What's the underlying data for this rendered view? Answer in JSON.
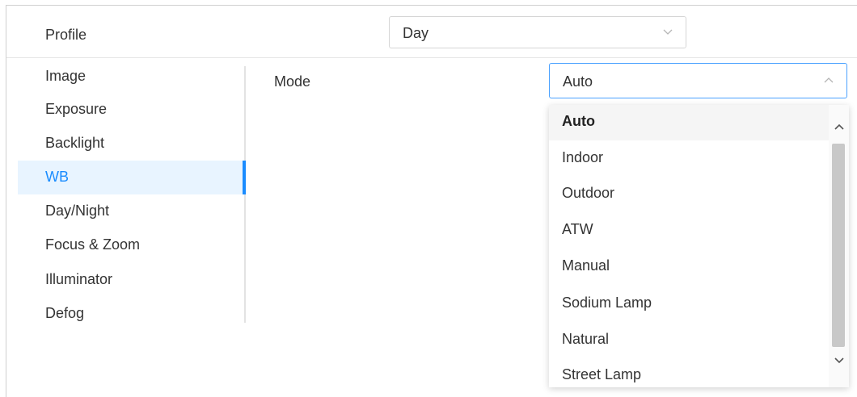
{
  "profile": {
    "label": "Profile",
    "value": "Day"
  },
  "sidebar": {
    "items": [
      {
        "label": "Image"
      },
      {
        "label": "Exposure"
      },
      {
        "label": "Backlight"
      },
      {
        "label": "WB"
      },
      {
        "label": "Day/Night"
      },
      {
        "label": "Focus & Zoom"
      },
      {
        "label": "Illuminator"
      },
      {
        "label": "Defog"
      }
    ],
    "active": "WB"
  },
  "mode": {
    "label": "Mode",
    "value": "Auto",
    "options": [
      {
        "label": "Auto"
      },
      {
        "label": "Indoor"
      },
      {
        "label": "Outdoor"
      },
      {
        "label": "ATW"
      },
      {
        "label": "Manual"
      },
      {
        "label": "Sodium Lamp"
      },
      {
        "label": "Natural"
      },
      {
        "label": "Street Lamp"
      }
    ],
    "selected": "Auto"
  },
  "icons": {
    "profile_select": "chevron-down-icon",
    "mode_select": "chevron-up-icon",
    "scroll_up": "scroll-up-icon",
    "scroll_down": "scroll-down-icon"
  },
  "colors": {
    "accent": "#1a8cff",
    "active_bg": "#e8f4ff"
  }
}
